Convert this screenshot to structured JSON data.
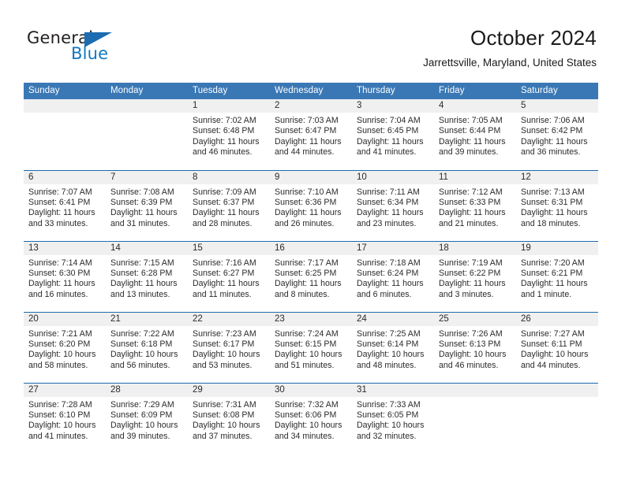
{
  "brand": {
    "name_part1": "General",
    "name_part2": "Blue",
    "triangle_icon": "triangle-icon",
    "colors": {
      "dark": "#231f20",
      "blue": "#1278be",
      "triangle": "#1b6cb0"
    }
  },
  "header": {
    "title": "October 2024",
    "subtitle": "Jarrettsville, Maryland, United States"
  },
  "theme": {
    "header_row_blue": "#3a78b5",
    "row_separator_blue": "#1b6cb0",
    "daynum_band_gray": "#f0f0f0",
    "text": "#2b2b2b"
  },
  "calendar": {
    "weekday_headers": [
      "Sunday",
      "Monday",
      "Tuesday",
      "Wednesday",
      "Thursday",
      "Friday",
      "Saturday"
    ],
    "labels": {
      "sunrise": "Sunrise:",
      "sunset": "Sunset:",
      "daylight": "Daylight:"
    },
    "weeks": [
      [
        {
          "day": "",
          "sunrise": "",
          "sunset": "",
          "daylight": "",
          "empty": true
        },
        {
          "day": "",
          "sunrise": "",
          "sunset": "",
          "daylight": "",
          "empty": true
        },
        {
          "day": "1",
          "sunrise": "Sunrise: 7:02 AM",
          "sunset": "Sunset: 6:48 PM",
          "daylight": "Daylight: 11 hours and 46 minutes."
        },
        {
          "day": "2",
          "sunrise": "Sunrise: 7:03 AM",
          "sunset": "Sunset: 6:47 PM",
          "daylight": "Daylight: 11 hours and 44 minutes."
        },
        {
          "day": "3",
          "sunrise": "Sunrise: 7:04 AM",
          "sunset": "Sunset: 6:45 PM",
          "daylight": "Daylight: 11 hours and 41 minutes."
        },
        {
          "day": "4",
          "sunrise": "Sunrise: 7:05 AM",
          "sunset": "Sunset: 6:44 PM",
          "daylight": "Daylight: 11 hours and 39 minutes."
        },
        {
          "day": "5",
          "sunrise": "Sunrise: 7:06 AM",
          "sunset": "Sunset: 6:42 PM",
          "daylight": "Daylight: 11 hours and 36 minutes."
        }
      ],
      [
        {
          "day": "6",
          "sunrise": "Sunrise: 7:07 AM",
          "sunset": "Sunset: 6:41 PM",
          "daylight": "Daylight: 11 hours and 33 minutes."
        },
        {
          "day": "7",
          "sunrise": "Sunrise: 7:08 AM",
          "sunset": "Sunset: 6:39 PM",
          "daylight": "Daylight: 11 hours and 31 minutes."
        },
        {
          "day": "8",
          "sunrise": "Sunrise: 7:09 AM",
          "sunset": "Sunset: 6:37 PM",
          "daylight": "Daylight: 11 hours and 28 minutes."
        },
        {
          "day": "9",
          "sunrise": "Sunrise: 7:10 AM",
          "sunset": "Sunset: 6:36 PM",
          "daylight": "Daylight: 11 hours and 26 minutes."
        },
        {
          "day": "10",
          "sunrise": "Sunrise: 7:11 AM",
          "sunset": "Sunset: 6:34 PM",
          "daylight": "Daylight: 11 hours and 23 minutes."
        },
        {
          "day": "11",
          "sunrise": "Sunrise: 7:12 AM",
          "sunset": "Sunset: 6:33 PM",
          "daylight": "Daylight: 11 hours and 21 minutes."
        },
        {
          "day": "12",
          "sunrise": "Sunrise: 7:13 AM",
          "sunset": "Sunset: 6:31 PM",
          "daylight": "Daylight: 11 hours and 18 minutes."
        }
      ],
      [
        {
          "day": "13",
          "sunrise": "Sunrise: 7:14 AM",
          "sunset": "Sunset: 6:30 PM",
          "daylight": "Daylight: 11 hours and 16 minutes."
        },
        {
          "day": "14",
          "sunrise": "Sunrise: 7:15 AM",
          "sunset": "Sunset: 6:28 PM",
          "daylight": "Daylight: 11 hours and 13 minutes."
        },
        {
          "day": "15",
          "sunrise": "Sunrise: 7:16 AM",
          "sunset": "Sunset: 6:27 PM",
          "daylight": "Daylight: 11 hours and 11 minutes."
        },
        {
          "day": "16",
          "sunrise": "Sunrise: 7:17 AM",
          "sunset": "Sunset: 6:25 PM",
          "daylight": "Daylight: 11 hours and 8 minutes."
        },
        {
          "day": "17",
          "sunrise": "Sunrise: 7:18 AM",
          "sunset": "Sunset: 6:24 PM",
          "daylight": "Daylight: 11 hours and 6 minutes."
        },
        {
          "day": "18",
          "sunrise": "Sunrise: 7:19 AM",
          "sunset": "Sunset: 6:22 PM",
          "daylight": "Daylight: 11 hours and 3 minutes."
        },
        {
          "day": "19",
          "sunrise": "Sunrise: 7:20 AM",
          "sunset": "Sunset: 6:21 PM",
          "daylight": "Daylight: 11 hours and 1 minute."
        }
      ],
      [
        {
          "day": "20",
          "sunrise": "Sunrise: 7:21 AM",
          "sunset": "Sunset: 6:20 PM",
          "daylight": "Daylight: 10 hours and 58 minutes."
        },
        {
          "day": "21",
          "sunrise": "Sunrise: 7:22 AM",
          "sunset": "Sunset: 6:18 PM",
          "daylight": "Daylight: 10 hours and 56 minutes."
        },
        {
          "day": "22",
          "sunrise": "Sunrise: 7:23 AM",
          "sunset": "Sunset: 6:17 PM",
          "daylight": "Daylight: 10 hours and 53 minutes."
        },
        {
          "day": "23",
          "sunrise": "Sunrise: 7:24 AM",
          "sunset": "Sunset: 6:15 PM",
          "daylight": "Daylight: 10 hours and 51 minutes."
        },
        {
          "day": "24",
          "sunrise": "Sunrise: 7:25 AM",
          "sunset": "Sunset: 6:14 PM",
          "daylight": "Daylight: 10 hours and 48 minutes."
        },
        {
          "day": "25",
          "sunrise": "Sunrise: 7:26 AM",
          "sunset": "Sunset: 6:13 PM",
          "daylight": "Daylight: 10 hours and 46 minutes."
        },
        {
          "day": "26",
          "sunrise": "Sunrise: 7:27 AM",
          "sunset": "Sunset: 6:11 PM",
          "daylight": "Daylight: 10 hours and 44 minutes."
        }
      ],
      [
        {
          "day": "27",
          "sunrise": "Sunrise: 7:28 AM",
          "sunset": "Sunset: 6:10 PM",
          "daylight": "Daylight: 10 hours and 41 minutes."
        },
        {
          "day": "28",
          "sunrise": "Sunrise: 7:29 AM",
          "sunset": "Sunset: 6:09 PM",
          "daylight": "Daylight: 10 hours and 39 minutes."
        },
        {
          "day": "29",
          "sunrise": "Sunrise: 7:31 AM",
          "sunset": "Sunset: 6:08 PM",
          "daylight": "Daylight: 10 hours and 37 minutes."
        },
        {
          "day": "30",
          "sunrise": "Sunrise: 7:32 AM",
          "sunset": "Sunset: 6:06 PM",
          "daylight": "Daylight: 10 hours and 34 minutes."
        },
        {
          "day": "31",
          "sunrise": "Sunrise: 7:33 AM",
          "sunset": "Sunset: 6:05 PM",
          "daylight": "Daylight: 10 hours and 32 minutes."
        },
        {
          "day": "",
          "sunrise": "",
          "sunset": "",
          "daylight": "",
          "empty": true
        },
        {
          "day": "",
          "sunrise": "",
          "sunset": "",
          "daylight": "",
          "empty": true
        }
      ]
    ]
  }
}
